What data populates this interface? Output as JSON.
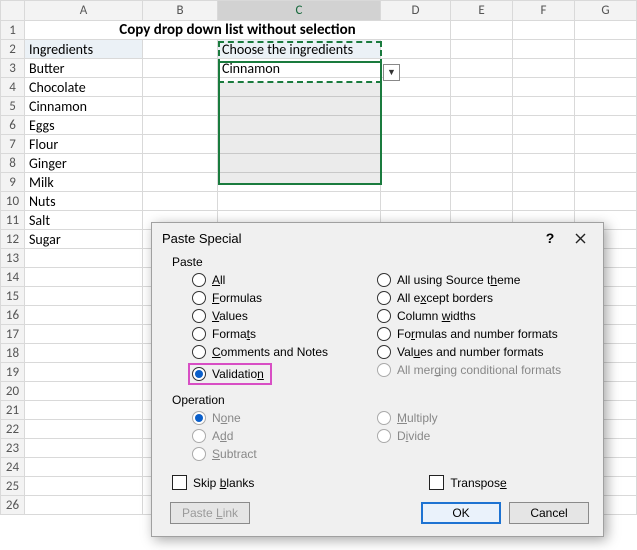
{
  "columns": [
    "A",
    "B",
    "C",
    "D",
    "E",
    "F",
    "G"
  ],
  "title": "Copy drop down list without selection",
  "a2": "Ingredients",
  "c2": "Choose the ingredients",
  "ingredients": [
    "Butter",
    "Chocolate",
    "Cinnamon",
    "Eggs",
    "Flour",
    "Ginger",
    "Milk",
    "Nuts",
    "Salt",
    "Sugar"
  ],
  "c3": "Cinnamon",
  "dialog": {
    "title": "Paste Special",
    "help": "?",
    "section_paste": "Paste",
    "section_operation": "Operation",
    "paste_left": [
      {
        "key": "all",
        "pre": "",
        "u": "A",
        "post": "ll"
      },
      {
        "key": "formulas",
        "pre": "",
        "u": "F",
        "post": "ormulas"
      },
      {
        "key": "values",
        "pre": "",
        "u": "V",
        "post": "alues"
      },
      {
        "key": "formats",
        "pre": "Forma",
        "u": "t",
        "post": "s"
      },
      {
        "key": "comments",
        "pre": "",
        "u": "C",
        "post": "omments and Notes"
      },
      {
        "key": "validation",
        "pre": "Validatio",
        "u": "n",
        "post": ""
      }
    ],
    "paste_right": [
      {
        "key": "allTheme",
        "pre": "All using Source t",
        "u": "h",
        "post": "eme"
      },
      {
        "key": "allExceptBorders",
        "pre": "All e",
        "u": "x",
        "post": "cept borders"
      },
      {
        "key": "columnWidths",
        "pre": "Column ",
        "u": "w",
        "post": "idths"
      },
      {
        "key": "formulasNum",
        "pre": "Fo",
        "u": "r",
        "post": "mulas and number formats"
      },
      {
        "key": "valuesNum",
        "pre": "Val",
        "u": "u",
        "post": "es and number formats"
      },
      {
        "key": "allMerge",
        "pre": "All mer",
        "u": "g",
        "post": "ing conditional formats"
      }
    ],
    "op_left": [
      {
        "key": "none",
        "pre": "N",
        "u": "o",
        "post": "ne"
      },
      {
        "key": "add",
        "pre": "A",
        "u": "d",
        "post": "d"
      },
      {
        "key": "subtract",
        "pre": "",
        "u": "S",
        "post": "ubtract"
      }
    ],
    "op_right": [
      {
        "key": "multiply",
        "pre": "",
        "u": "M",
        "post": "ultiply"
      },
      {
        "key": "divide",
        "pre": "D",
        "u": "i",
        "post": "vide"
      }
    ],
    "skip_blanks": {
      "pre": "Skip ",
      "u": "b",
      "post": "lanks"
    },
    "transpose": {
      "pre": "Transpos",
      "u": "e",
      "post": ""
    },
    "paste_link": {
      "pre": "Paste ",
      "u": "L",
      "post": "ink"
    },
    "ok": "OK",
    "cancel": "Cancel"
  }
}
